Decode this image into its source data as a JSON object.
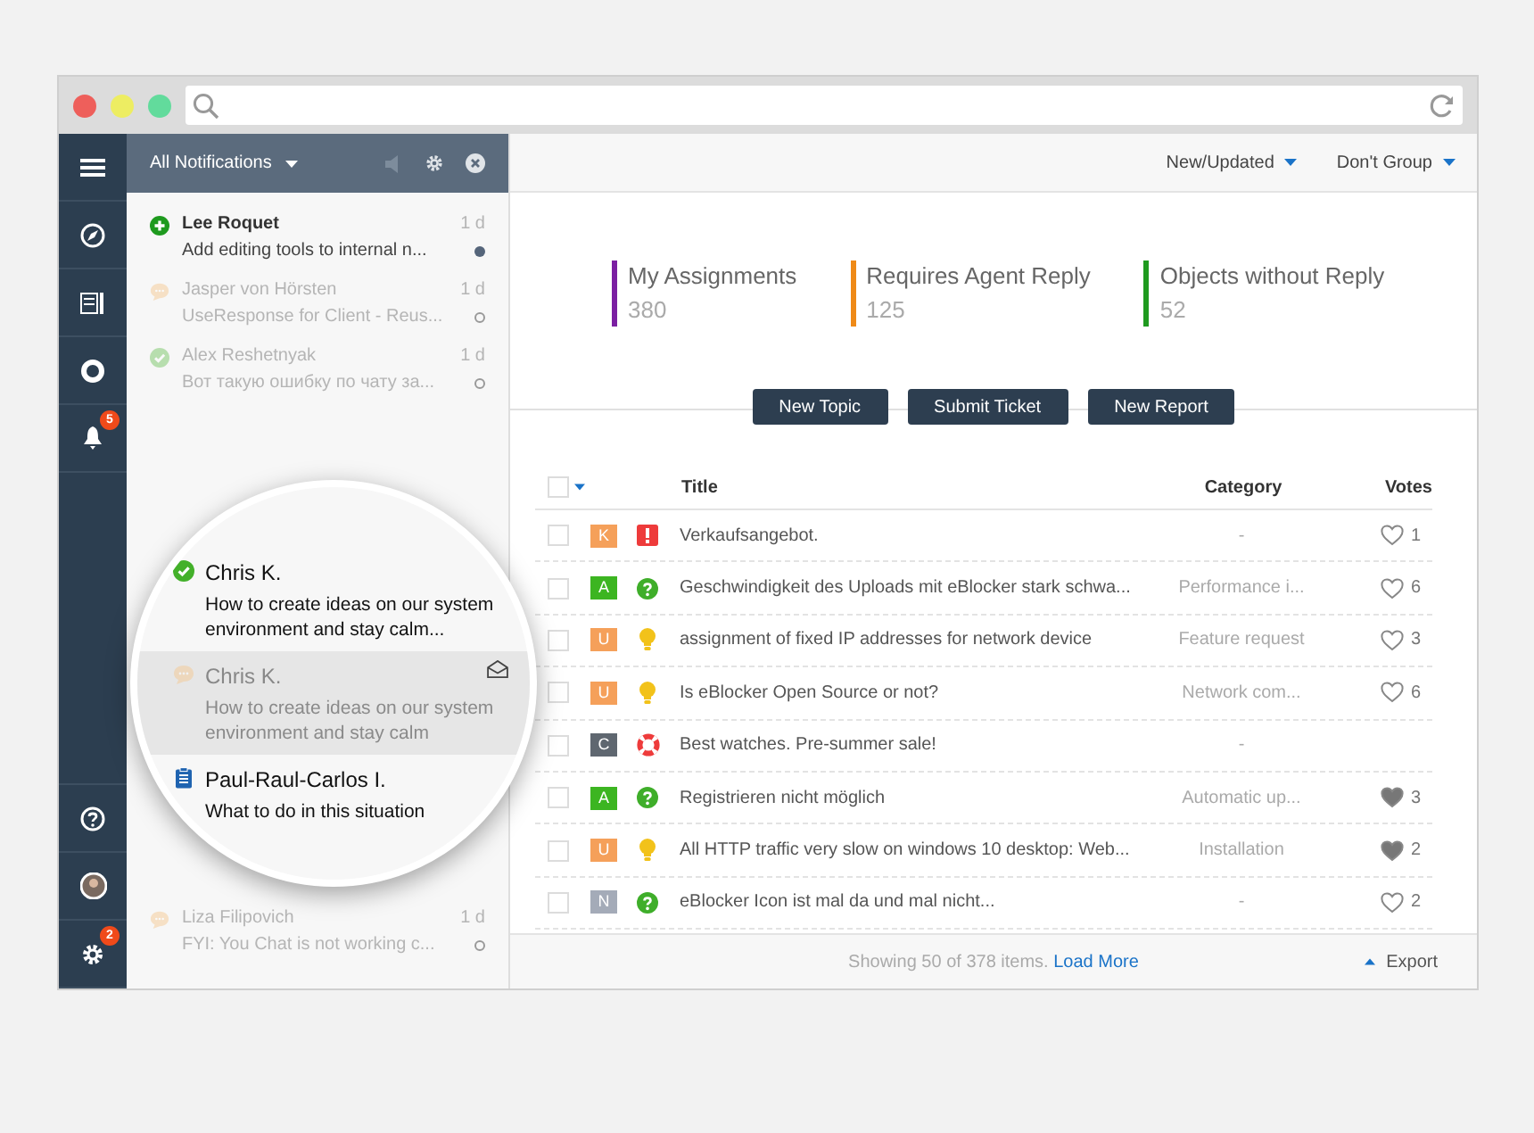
{
  "rail": {
    "top": [
      {
        "kind": "menu"
      },
      {
        "kind": "compass"
      },
      {
        "kind": "book"
      },
      {
        "kind": "ring"
      },
      {
        "kind": "bell",
        "badge": "5"
      }
    ],
    "bottom": [
      {
        "kind": "help"
      },
      {
        "kind": "avatar"
      },
      {
        "kind": "gear",
        "badge": "2"
      }
    ]
  },
  "notifications": {
    "title": "All Notifications",
    "items": [
      {
        "kind": "plus",
        "name": "Lee Roquet",
        "message": "Add editing tools to internal n...",
        "time": "1 d",
        "unread": true
      },
      {
        "kind": "chat",
        "name": "Jasper von Hörsten",
        "message": "UseResponse for Client - Reus...",
        "time": "1 d",
        "unread": false
      },
      {
        "kind": "check",
        "name": "Alex Reshetnyak",
        "message": "Вот такую ошибку по чату за...",
        "time": "1 d",
        "unread": false
      }
    ],
    "bottom_items": [
      {
        "kind": "chat",
        "name": "Liza Filipovich",
        "message": "FYI: You Chat is not working c...",
        "time": "1 d",
        "unread": false
      }
    ]
  },
  "magnifier": {
    "items": [
      {
        "kind": "check",
        "name": "Chris K.",
        "message": "How to create ideas on our system environment and stay calm...",
        "unread": true,
        "selected": false
      },
      {
        "kind": "chat",
        "name": "Chris K.",
        "message": "How to create ideas on our system environment and stay calm",
        "unread": false,
        "selected": true
      },
      {
        "kind": "clipboard",
        "name": "Paul-Raul-Carlos I.",
        "message": "What to do in this situation",
        "unread": true,
        "selected": false
      }
    ]
  },
  "toolbar": {
    "sort": "New/Updated",
    "group": "Don't Group"
  },
  "stats": [
    {
      "label": "My Assignments",
      "value": "380",
      "color": "#7b1fa2"
    },
    {
      "label": "Requires Agent Reply",
      "value": "125",
      "color": "#ef8a17"
    },
    {
      "label": "Objects without Reply",
      "value": "52",
      "color": "#1f9a1f"
    }
  ],
  "buttons": [
    "New Topic",
    "Submit Ticket",
    "New Report"
  ],
  "table": {
    "select_all_checked": false,
    "columns": [
      "Title",
      "Category",
      "Votes"
    ],
    "rows": [
      {
        "letter": "K",
        "color": "#f5a05a",
        "kind": "alert",
        "title": "Verkaufsangebot.",
        "category": "-",
        "votes": "1",
        "voted": false,
        "checked": false
      },
      {
        "letter": "A",
        "color": "#3cb521",
        "kind": "question",
        "title": "Geschwindigkeit des Uploads mit eBlocker stark schwa...",
        "category": "Performance i...",
        "votes": "6",
        "voted": false,
        "checked": false
      },
      {
        "letter": "U",
        "color": "#f5a05a",
        "kind": "idea",
        "title": "assignment of fixed IP addresses for network device",
        "category": "Feature request",
        "votes": "3",
        "voted": false,
        "checked": false
      },
      {
        "letter": "U",
        "color": "#f5a05a",
        "kind": "idea",
        "title": "Is eBlocker Open Source or not?",
        "category": "Network com...",
        "votes": "6",
        "voted": false,
        "checked": false
      },
      {
        "letter": "C",
        "color": "#5f6770",
        "kind": "help",
        "title": "Best watches. Pre-summer sale!",
        "category": "-",
        "votes": "",
        "checked": false
      },
      {
        "letter": "A",
        "color": "#3cb521",
        "kind": "question",
        "title": "Registrieren nicht möglich",
        "category": "Automatic up...",
        "votes": "3",
        "voted": true,
        "checked": false
      },
      {
        "letter": "U",
        "color": "#f5a05a",
        "kind": "idea",
        "title": "All HTTP traffic very slow on windows 10 desktop: Web...",
        "category": "Installation",
        "votes": "2",
        "voted": true,
        "checked": false
      },
      {
        "letter": "N",
        "color": "#a4abb8",
        "kind": "question",
        "title": "eBlocker Icon ist mal da und mal nicht...",
        "category": "-",
        "votes": "2",
        "voted": false,
        "checked": false
      }
    ]
  },
  "footer": {
    "showing": "Showing 50 of 378 items.",
    "load_more": "Load More",
    "export": "Export"
  }
}
